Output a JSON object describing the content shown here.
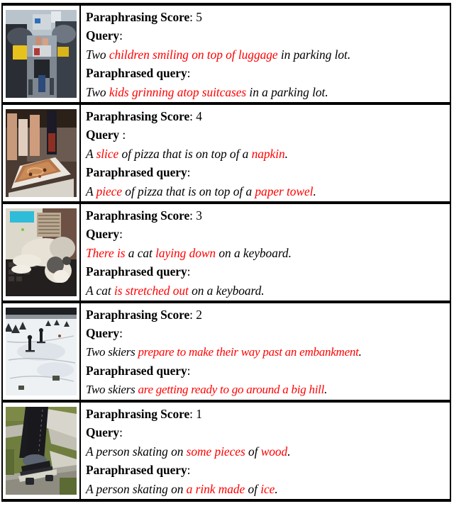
{
  "figure": {
    "type": "qualitative-examples-table",
    "column_headers_visible": false,
    "score_label": "Paraphrasing Score",
    "query_label": "Query",
    "paraphrased_label": "Paraphrased query",
    "highlight_color": "#ff0000",
    "text_color": "#000000",
    "background_color": "#ffffff"
  },
  "rows": [
    {
      "score_label": "Paraphrasing Score",
      "score_separator": ": ",
      "score_value": "5",
      "query_label": "Query",
      "query_separator": ":",
      "query_parts": [
        {
          "text": "Two ",
          "highlight": false
        },
        {
          "text": "children smiling on top of luggage",
          "highlight": true
        },
        {
          "text": " in parking lot.",
          "highlight": false
        }
      ],
      "paraphrased_label": "Paraphrased query",
      "paraphrased_separator": ":",
      "paraphrased_parts": [
        {
          "text": "Two ",
          "highlight": false
        },
        {
          "text": "kids grinning atop suitcases",
          "highlight": true
        },
        {
          "text": " in a parking lot.",
          "highlight": false
        }
      ],
      "image_alt": "two children sitting on luggage between parked cars in a parking lot"
    },
    {
      "score_label": "Paraphrasing Score",
      "score_separator": ": ",
      "score_value": "4",
      "query_label": "Query",
      "query_separator": " :",
      "query_parts": [
        {
          "text": "A ",
          "highlight": false
        },
        {
          "text": "slice",
          "highlight": true
        },
        {
          "text": " of pizza that is on top of a ",
          "highlight": false
        },
        {
          "text": "napkin",
          "highlight": true
        },
        {
          "text": ".",
          "highlight": false
        }
      ],
      "paraphrased_label": "Paraphrased query",
      "paraphrased_separator": ":",
      "paraphrased_parts": [
        {
          "text": "A ",
          "highlight": false
        },
        {
          "text": "piece",
          "highlight": true
        },
        {
          "text": " of pizza that is on top of a ",
          "highlight": false
        },
        {
          "text": "paper towel",
          "highlight": true
        },
        {
          "text": ".",
          "highlight": false
        }
      ],
      "image_alt": "slice of pizza on a white napkin on a table with condiment bottles"
    },
    {
      "score_label": "Paraphrasing Score",
      "score_separator": ": ",
      "score_value": "3",
      "query_label": "Query",
      "query_separator": ":",
      "query_parts": [
        {
          "text": "There is",
          "highlight": true
        },
        {
          "text": " a cat ",
          "highlight": false
        },
        {
          "text": "laying down",
          "highlight": true
        },
        {
          "text": " on a keyboard.",
          "highlight": false
        }
      ],
      "paraphrased_label": "Paraphrased query",
      "paraphrased_separator": ":",
      "paraphrased_parts": [
        {
          "text": "A cat ",
          "highlight": false
        },
        {
          "text": "is stretched out",
          "highlight": true
        },
        {
          "text": " on a keyboard.",
          "highlight": false
        }
      ],
      "image_alt": "a cat lying across a computer keyboard in front of a monitor"
    },
    {
      "score_label": "Paraphrasing Score",
      "score_separator": ": ",
      "score_value": "2",
      "query_label": "Query",
      "query_separator": ":",
      "query_parts": [
        {
          "text": "Two skiers ",
          "highlight": false
        },
        {
          "text": "prepare to make their way past an embankment",
          "highlight": true
        },
        {
          "text": ".",
          "highlight": false
        }
      ],
      "paraphrased_label": "Paraphrased query",
      "paraphrased_separator": ":",
      "paraphrased_parts": [
        {
          "text": "Two skiers ",
          "highlight": false
        },
        {
          "text": "are getting ready to go around a big hill",
          "highlight": true
        },
        {
          "text": ".",
          "highlight": false
        }
      ],
      "image_alt": "two skiers standing on a snowy hillside slope"
    },
    {
      "score_label": "Paraphrasing Score",
      "score_separator": ": ",
      "score_value": "1",
      "query_label": "Query",
      "query_separator": ":",
      "query_parts": [
        {
          "text": "A person skating on ",
          "highlight": false
        },
        {
          "text": "some pieces",
          "highlight": true
        },
        {
          "text": " of ",
          "highlight": false
        },
        {
          "text": "wood",
          "highlight": true
        },
        {
          "text": ".",
          "highlight": false
        }
      ],
      "paraphrased_label": "Paraphrased query",
      "paraphrased_separator": ":",
      "paraphrased_parts": [
        {
          "text": "A person skating on ",
          "highlight": false
        },
        {
          "text": "a rink made",
          "highlight": true
        },
        {
          "text": " of ",
          "highlight": false
        },
        {
          "text": "ice",
          "highlight": true
        },
        {
          "text": ".",
          "highlight": false
        }
      ],
      "image_alt": "skateboarder's leg and board on a wooden ramp over grass"
    }
  ]
}
